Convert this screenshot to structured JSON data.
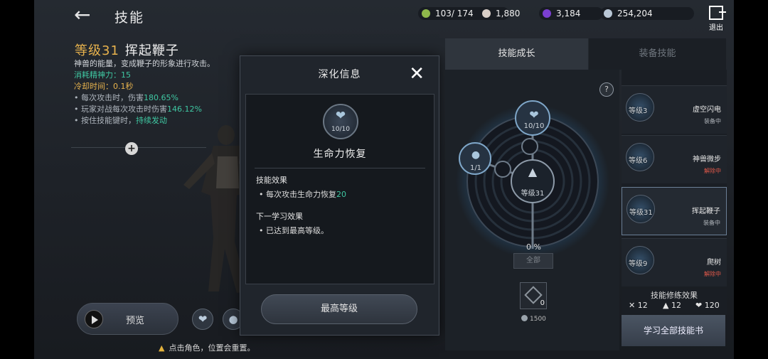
{
  "header": {
    "title": "技能",
    "resources": [
      {
        "icon": "stamina-icon",
        "value": "103/ 174",
        "color": "#8fb84b"
      },
      {
        "icon": "pearl-icon",
        "value": "1,880",
        "color": "#d9cfc8"
      },
      {
        "icon": "purple-gem-icon",
        "value": "3,184",
        "color": "#7b3fd1"
      },
      {
        "icon": "silver-coin-icon",
        "value": "254,204",
        "color": "#b9c7d6"
      }
    ],
    "exit_label": "退出"
  },
  "skill": {
    "level": "等级31",
    "name": "挥起鞭子",
    "description": "神兽的能量，变成鞭子的形象进行攻击。",
    "cost_label": "消耗精神力：",
    "cost_value": "15",
    "cooldown_label": "冷却时间：",
    "cooldown_value": "0.1秒",
    "effects": [
      {
        "text": "每次攻击时，伤害",
        "value": "180.65%"
      },
      {
        "text": "玩家对战每次攻击时伤害",
        "value": "146.12%"
      },
      {
        "text": "按住技能键时，",
        "value": "持续发动"
      }
    ]
  },
  "preview": {
    "label": "预览"
  },
  "warning": {
    "text": "点击角色，位置会重置。"
  },
  "modal": {
    "title": "深化信息",
    "medal_count": "10/10",
    "node_name": "生命力恢复",
    "effect_title": "技能效果",
    "effect_text": "每次攻击生命力恢复",
    "effect_value": "20",
    "next_title": "下一学习效果",
    "next_text": "已达到最高等级。",
    "max_button": "最高等级"
  },
  "tabs": {
    "growth": "技能成长",
    "equip": "装备技能"
  },
  "tree": {
    "top_node_count": "10/10",
    "left_node_count": "1/1",
    "center_level": "等级31",
    "percent": "0 %",
    "all_button": "全部",
    "book_count": "0",
    "book_cost": "1500"
  },
  "equipped": [
    {
      "level": "等级3",
      "name": "虚空闪电",
      "status": "装备中",
      "status_color": "#b0b5bb"
    },
    {
      "level": "等级6",
      "name": "神兽微步",
      "status": "解除中",
      "status_color": "#e0584a"
    },
    {
      "level": "等级31",
      "name": "挥起鞭子",
      "status": "装备中",
      "status_color": "#b0b5bb"
    },
    {
      "level": "等级9",
      "name": "爬树",
      "status": "解除中",
      "status_color": "#e0584a"
    }
  ],
  "training": {
    "title": "技能修练效果",
    "values": [
      {
        "icon": "sword-icon",
        "value": "12"
      },
      {
        "icon": "shield-icon",
        "value": "12"
      },
      {
        "icon": "heart-icon",
        "value": "120"
      }
    ]
  },
  "learn_button": "学习全部技能书"
}
